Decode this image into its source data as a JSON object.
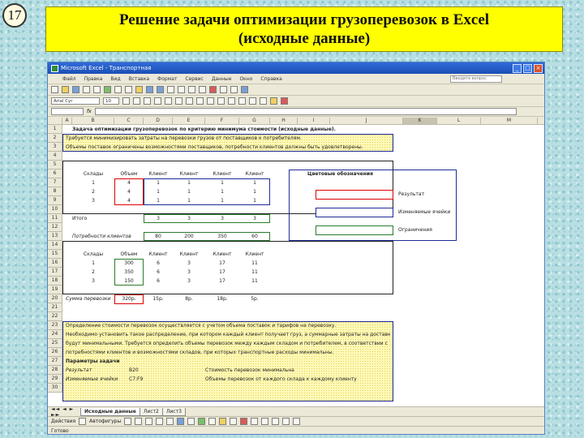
{
  "slide": {
    "number": "17",
    "title_line1": "Решение задачи оптимизации грузоперевозок в Excel",
    "title_line2": "(исходные данные)"
  },
  "excel": {
    "window_title": "Microsoft Excel - Транспортная",
    "menu": [
      "Файл",
      "Правка",
      "Вид",
      "Вставка",
      "Формат",
      "Сервис",
      "Данные",
      "Окно",
      "Справка"
    ],
    "help_placeholder": "Введите вопрос",
    "font_name": "Arial Cyr",
    "font_size": "10",
    "col_headers": [
      "A",
      "B",
      "C",
      "D",
      "E",
      "F",
      "G",
      "H",
      "I",
      "J",
      "K",
      "L",
      "M"
    ],
    "row_numbers": [
      "1",
      "2",
      "3",
      "4",
      "5",
      "6",
      "7",
      "8",
      "9",
      "10",
      "11",
      "12",
      "13",
      "14",
      "15",
      "16",
      "17",
      "18",
      "19",
      "20",
      "21",
      "22",
      "23",
      "24",
      "25",
      "26",
      "27",
      "28",
      "29",
      "30"
    ],
    "cells": {
      "title": "Задача оптимизации грузоперевозок по критерию минимума стоимости (исходные данные).",
      "desc2": "Требуется минимизировать затраты на перевозки грузов от поставщиков к потребителям.",
      "desc3": "Объемы поставок ограничены возможностями поставщиков, потребности клиентов должны быть удовлетворены.",
      "supplier_hdr": "Склады",
      "volume_hdr": "Объем",
      "clients": [
        "Клиент",
        "Клиент",
        "Клиент",
        "Клиент"
      ],
      "rows_ids": [
        "1",
        "2",
        "3"
      ],
      "plan_vol": [
        "4",
        "4",
        "4"
      ],
      "plan": [
        [
          "1",
          "1",
          "1",
          "1"
        ],
        [
          "1",
          "1",
          "1",
          "1"
        ],
        [
          "1",
          "1",
          "1",
          "1"
        ]
      ],
      "total_label": "Итого",
      "totals": [
        "3",
        "3",
        "3",
        "3"
      ],
      "demand_label": "Потребности клиентов",
      "demand": [
        "80",
        "200",
        "350",
        "60"
      ],
      "stock": [
        "300",
        "350",
        "150"
      ],
      "costs": [
        [
          "6",
          "3",
          "17",
          "11"
        ],
        [
          "6",
          "3",
          "17",
          "11"
        ],
        [
          "6",
          "3",
          "17",
          "11"
        ]
      ],
      "cost_total_label": "Сумма перевозки",
      "cost_total": "320р.",
      "cost_parts": [
        "15р.",
        "8р.",
        "18р.",
        "5р."
      ],
      "legend_title": "Цветовые обозначения",
      "legend_result": "Результат",
      "legend_vars": "Изменяемые ячейки",
      "legend_limits": "Ограничения",
      "notes": [
        "Определение стоимости перевозок осуществляется с учетом объема поставок и тарифов на перевозку.",
        "Необходимо установить такое распределение, при котором каждый клиент получает груз, а суммарные затраты на доставку",
        "будут минимальными. Требуется определить объемы перевозок между каждым складом и потребителем, в соответствии с",
        "потребностями клиентов и возможностями складов, при которых транспортные расходы минимальны."
      ],
      "params_label": "Параметры задачи",
      "param_result": "Результат",
      "param_result_ref": "B20",
      "param_result_desc": "Стоимость перевозок минимальна",
      "param_vars": "Изменяемые ячейки",
      "param_vars_ref": "C7:F9",
      "param_vars_desc": "Объемы перевозок от каждого склада к каждому клиенту"
    },
    "sheet_tabs": [
      "Исходные данные",
      "Лист2",
      "Лист3"
    ],
    "draw_label": "Действия",
    "autoshapes_label": "Автофигуры",
    "status": "Готово"
  },
  "colors": {
    "title_bg": "#ffff00",
    "result": "#e00000",
    "variables": "#1e2b9a",
    "limits": "#2a7d2a"
  }
}
